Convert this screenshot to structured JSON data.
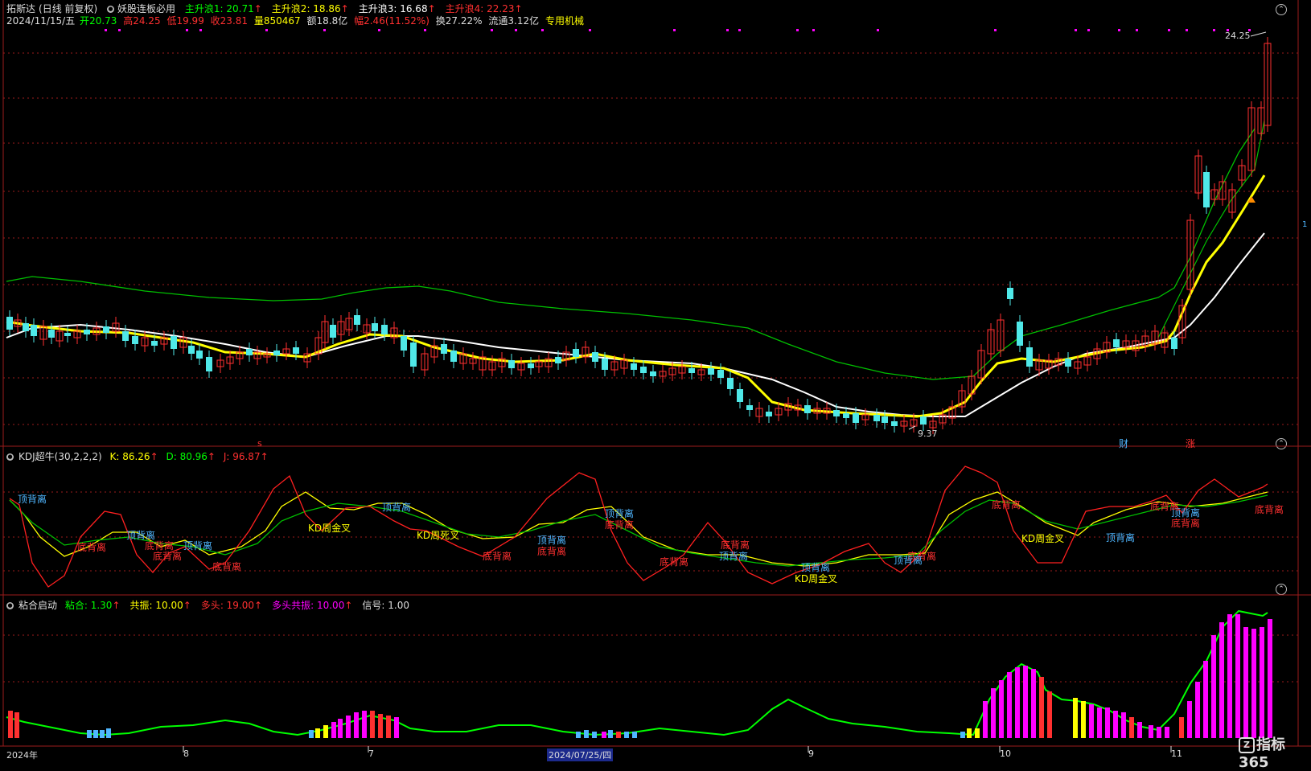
{
  "header": {
    "stock_name": "拓斯达",
    "period": "(日线 前复权)",
    "indicator": "妖股连板必用",
    "waves": [
      {
        "label": "主升浪1",
        "value": "20.71",
        "color": "#00ff00"
      },
      {
        "label": "主升浪2",
        "value": "18.86",
        "color": "#ffff00"
      },
      {
        "label": "主升浪3",
        "value": "16.68",
        "color": "#ffffff"
      },
      {
        "label": "主升浪4",
        "value": "22.23",
        "color": "#ff3030"
      }
    ]
  },
  "quote": {
    "date": "2024/11/15/五",
    "open_label": "开",
    "open": "20.73",
    "high_label": "高",
    "high": "24.25",
    "low_label": "低",
    "low": "19.99",
    "close_label": "收",
    "close": "23.81",
    "volume_label": "量",
    "volume": "850467",
    "amount_label": "额",
    "amount": "18.8亿",
    "change_label": "幅",
    "change": "2.46(11.52%)",
    "turnover": "换27.22%",
    "float": "流通3.12亿",
    "sector": "专用机械"
  },
  "main_chart": {
    "max_label": "24.25",
    "min_label": "9.37",
    "markers": {
      "s": "s",
      "cai": "财",
      "zhang": "涨"
    }
  },
  "kdj": {
    "title": "KDJ超牛(30,2,2,2)",
    "k_label": "K",
    "k": "86.26",
    "d_label": "D",
    "d": "80.96",
    "j_label": "J",
    "j": "96.87",
    "annotations": [
      {
        "text": "顶背离",
        "color": "#4fb6ff"
      },
      {
        "text": "底背离",
        "color": "#ff3030"
      },
      {
        "text": "顶背离",
        "color": "#4fb6ff"
      },
      {
        "text": "底背离",
        "color": "#ff3030"
      },
      {
        "text": "顶背离",
        "color": "#4fb6ff"
      },
      {
        "text": "底背离",
        "color": "#ff3030"
      },
      {
        "text": "底背离",
        "color": "#ff3030"
      },
      {
        "text": "KD周金叉",
        "color": "#ffff00"
      },
      {
        "text": "顶背离",
        "color": "#4fb6ff"
      },
      {
        "text": "KD周死叉",
        "color": "#ffff00"
      },
      {
        "text": "底背离",
        "color": "#ff3030"
      },
      {
        "text": "顶背离",
        "color": "#4fb6ff"
      },
      {
        "text": "底背离",
        "color": "#ff3030"
      },
      {
        "text": "顶背离",
        "color": "#4fb6ff"
      },
      {
        "text": "底背离",
        "color": "#ff3030"
      },
      {
        "text": "底背离",
        "color": "#ff3030"
      },
      {
        "text": "顶背离",
        "color": "#4fb6ff"
      },
      {
        "text": "底背离",
        "color": "#ff3030"
      },
      {
        "text": "顶背离",
        "color": "#4fb6ff"
      },
      {
        "text": "KD周金叉",
        "color": "#ffff00"
      },
      {
        "text": "底背离",
        "color": "#ff3030"
      },
      {
        "text": "顶背离",
        "color": "#4fb6ff"
      },
      {
        "text": "底背离",
        "color": "#ff3030"
      },
      {
        "text": "KD周金叉",
        "color": "#ffff00"
      },
      {
        "text": "顶背离",
        "color": "#4fb6ff"
      },
      {
        "text": "底背离",
        "color": "#ff3030"
      },
      {
        "text": "顶背离",
        "color": "#4fb6ff"
      },
      {
        "text": "底背离",
        "color": "#ff3030"
      },
      {
        "text": "底背离",
        "color": "#ff3030"
      }
    ]
  },
  "nianhe": {
    "title": "粘合启动",
    "items": [
      {
        "label": "粘合",
        "value": "1.30",
        "color": "#00ff00",
        "arrow": "↑"
      },
      {
        "label": "共振",
        "value": "10.00",
        "color": "#ffff00",
        "arrow": "↑"
      },
      {
        "label": "多头",
        "value": "19.00",
        "color": "#ff3030",
        "arrow": "↑"
      },
      {
        "label": "多头共振",
        "value": "10.00",
        "color": "#ff00ff",
        "arrow": "↑"
      },
      {
        "label": "信号",
        "value": "1.00",
        "color": "#dddddd",
        "arrow": ""
      }
    ]
  },
  "time_axis": {
    "labels": [
      "2024年",
      "8",
      "7",
      "2024/07/25/四",
      "9",
      "10",
      "11"
    ]
  },
  "right_axis": {
    "marker": "1"
  },
  "watermark": "指标365",
  "colors": {
    "up": "#ff3030",
    "down": "#4fe8e8",
    "ma_yellow": "#ffff00",
    "ma_white": "#ffffff",
    "band_green": "#00c000",
    "kdj_k": "#ffff00",
    "kdj_d": "#00c000",
    "kdj_j": "#ff2020",
    "grid": "#9b1b1b"
  }
}
